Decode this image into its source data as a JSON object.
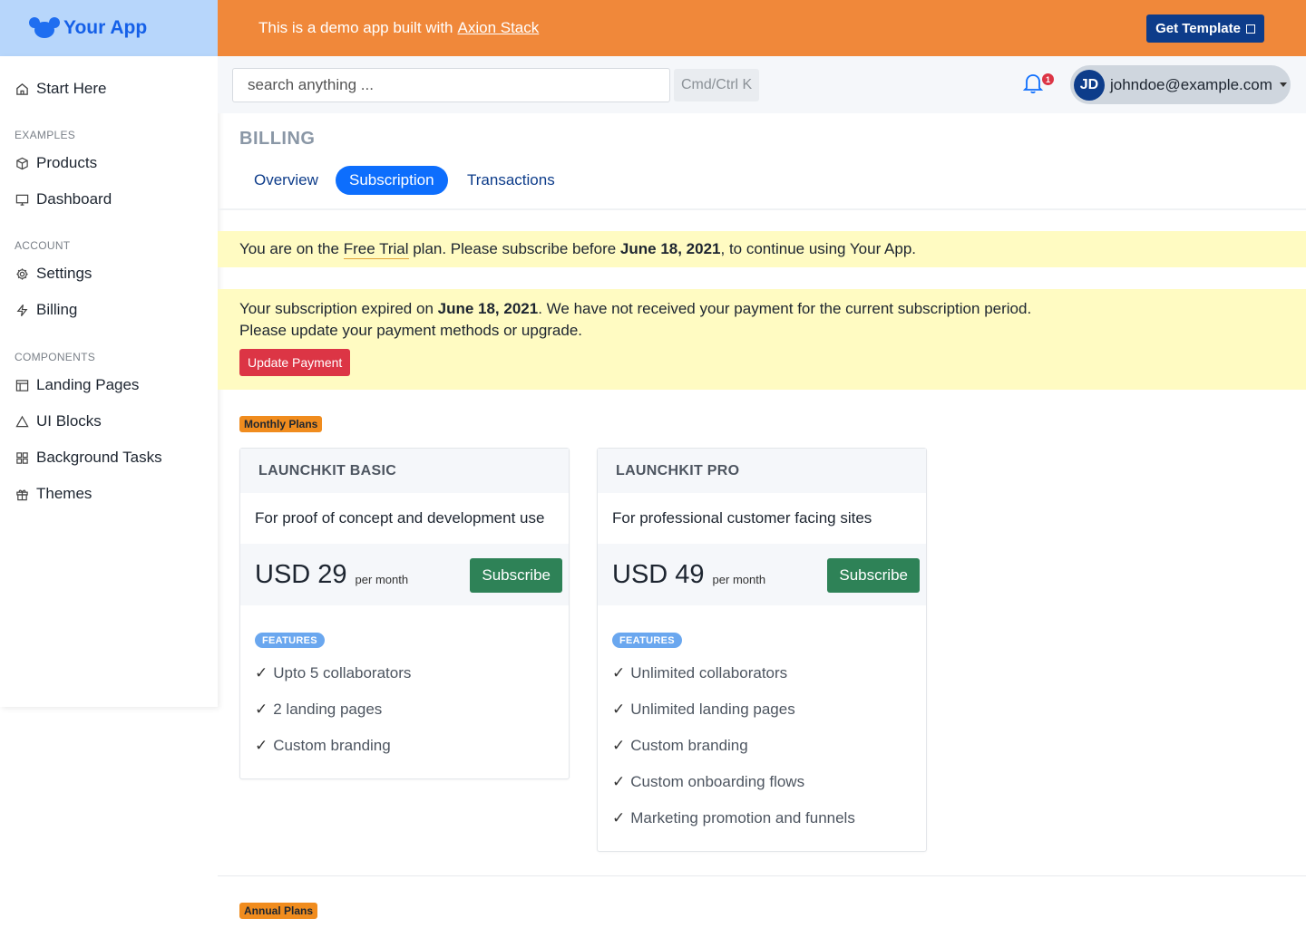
{
  "brand": {
    "name": "Your App"
  },
  "banner": {
    "text": "This is a demo app built with",
    "link": "Axion Stack",
    "cta": "Get Template"
  },
  "sidebar": {
    "start": "Start Here",
    "sections": [
      {
        "title": "EXAMPLES",
        "items": [
          "Products",
          "Dashboard"
        ]
      },
      {
        "title": "ACCOUNT",
        "items": [
          "Settings",
          "Billing"
        ]
      },
      {
        "title": "COMPONENTS",
        "items": [
          "Landing Pages",
          "UI Blocks",
          "Background Tasks",
          "Themes"
        ]
      }
    ]
  },
  "header": {
    "search_placeholder": "search anything ...",
    "shortcut": "Cmd/Ctrl K",
    "notification_count": "1",
    "user": {
      "initials": "JD",
      "email": "johndoe@example.com"
    }
  },
  "page": {
    "title": "BILLING",
    "tabs": [
      "Overview",
      "Subscription",
      "Transactions"
    ],
    "active_tab": "Subscription"
  },
  "alerts": {
    "trial": {
      "pre": "You are on the ",
      "plan": "Free Trial",
      "mid": " plan. Please subscribe before ",
      "date": "June 18, 2021",
      "post": ", to continue using Your App."
    },
    "expired": {
      "pre": "Your subscription expired on ",
      "date": "June 18, 2021",
      "post": ". We have not received your payment for the current subscription period.",
      "line2": "Please update your payment methods or upgrade.",
      "button": "Update Payment"
    }
  },
  "plans": {
    "monthly_label": "Monthly Plans",
    "annual_label": "Annual Plans",
    "features_label": "FEATURES",
    "subscribe_label": "Subscribe",
    "per_label": "per month",
    "items": [
      {
        "name": "LAUNCHKIT BASIC",
        "description": "For proof of concept and development use",
        "price": "USD 29",
        "features": [
          "Upto 5 collaborators",
          "2 landing pages",
          "Custom branding"
        ]
      },
      {
        "name": "LAUNCHKIT PRO",
        "description": "For professional customer facing sites",
        "price": "USD 49",
        "features": [
          "Unlimited collaborators",
          "Unlimited landing pages",
          "Custom branding",
          "Custom onboarding flows",
          "Marketing promotion and funnels"
        ]
      }
    ]
  },
  "colors": {
    "accent": "#0d6efd",
    "banner": "#f0883a",
    "brand_bg": "#b7d6fb",
    "alert_bg": "#fffbc2",
    "subscribe": "#2e8257",
    "danger": "#dc3545"
  }
}
